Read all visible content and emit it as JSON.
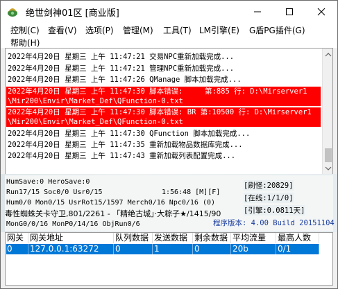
{
  "window": {
    "title": "绝世剑神01区 [商业版]",
    "controls": {
      "minimize": "–",
      "maximize": "☐",
      "close": "✕"
    }
  },
  "menu": {
    "items": [
      "控制(C)",
      "查看(V)",
      "选项(P)",
      "管理(M)",
      "工具(T)",
      "LM引擎(E)",
      "G盾PG插件(G)",
      "帮助(H)"
    ]
  },
  "log": {
    "lines": [
      "2022年4月20日 星期三 上午 11:47:21 交易NPC重新加载完成...",
      "2022年4月20日 星期三 上午 11:47:21 管理NPC重新加载完成...",
      "2022年4月20日 星期三 上午 11:47:26 QManage 脚本加载完成...",
      "2022年4月20日 星期三 上午 11:47:30 脚本错误:     第:885 行: D:\\Mirserver1",
      "\\Mir200\\Envir\\Market_Def\\QFunction-0.txt",
      "2022年4月20日 星期三 上午 11:47:30 脚本错误: BR 第:10500 行: D:\\Mirserver1",
      "\\Mir200\\Envir\\Market_Def\\QFunction-0.txt",
      "2022年4月20日 星期三 上午 11:47:30 QFunction 脚本加载完成...",
      "2022年4月20日 星期三 上午 11:47:35 重新加载物品数据库完成...",
      "2022年4月20日 星期三 上午 11:47:43 重新加载列表配置完成..."
    ],
    "highlight_color": "#ff0000"
  },
  "status": {
    "line1": "HumSave:0 HeroSave:0",
    "line2_left": "Run17/15 Soc0/0 Usr0/15",
    "line2_time": "1:56:48 [M][F]",
    "line3": "Hum0/0 Mon0/15 UsrRot15/1597 Merch0/16 Npc0/16 (0)",
    "line4": "毒性蜘蛛关卡守卫,801/2261 - 「精绝古城」·大粽子★/1415/90",
    "line5": "MonG0/0/16 MonP0/14/16 ObjRun0/6",
    "refresh": "[刷怪:20829]",
    "online": "[在线:1/1/0]",
    "engine": "[引擎:0.0811天]",
    "version": "程序版本: 4.00 Build 20151104",
    "version_color": "#1a3c9e"
  },
  "gateway_table": {
    "headers": [
      "网关",
      "网关地址",
      "队列数据",
      "发送数据",
      "剩余数据",
      "平均流量",
      "最高人数"
    ],
    "rows": [
      [
        "0",
        "127.0.0.1:63272",
        "0",
        "1",
        "0",
        "20b",
        "0/1"
      ]
    ],
    "selection_color": "#0078d7"
  }
}
